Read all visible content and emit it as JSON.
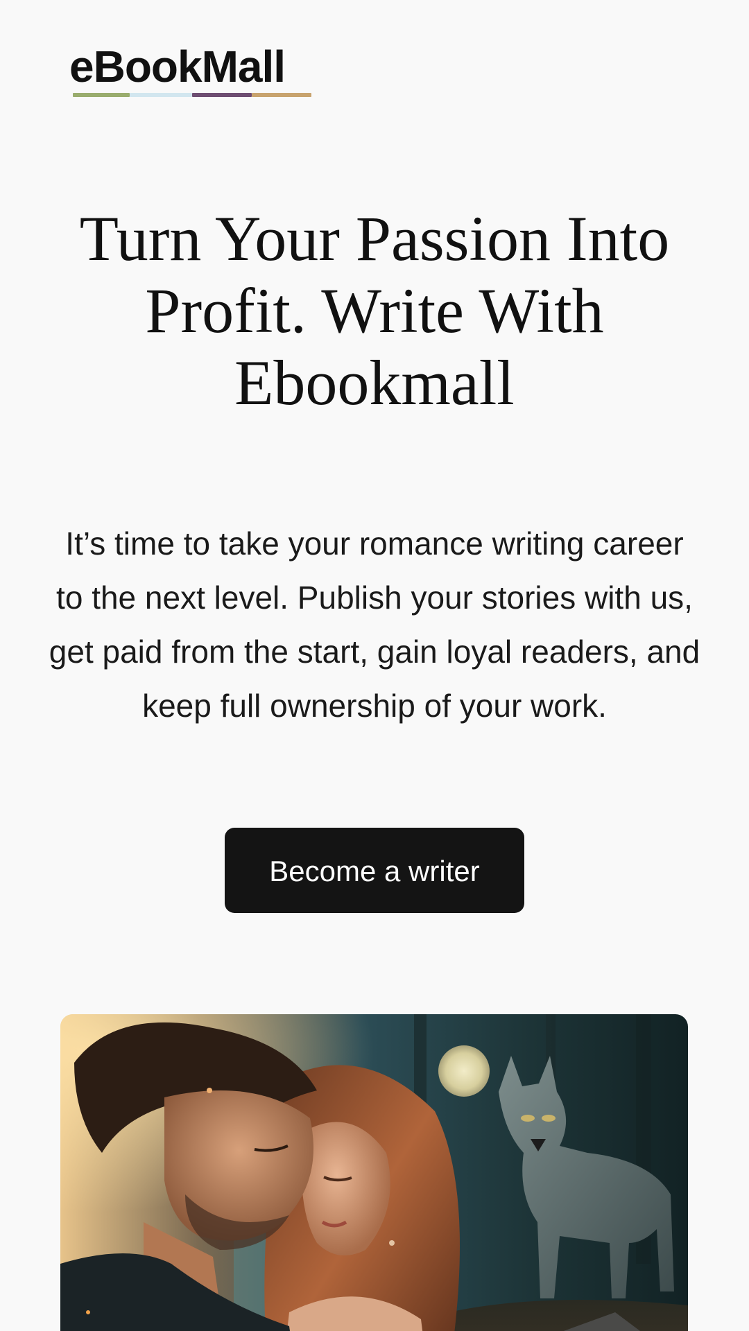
{
  "brand": {
    "logo_text": "eBookMall",
    "logo_stripe_colors": [
      "#9aad6e",
      "#d2e6ef",
      "#6e4e72",
      "#c8a36e"
    ]
  },
  "hero": {
    "title": "Turn Your Passion Into Profit. Write With Ebookmall",
    "description": "It’s time to take your romance writing career to the next level. Publish your stories with us, get paid from the start, gain loyal readers, and keep full ownership of your work.",
    "cta_label": "Become a writer"
  },
  "colors": {
    "background": "#f9f9f9",
    "text": "#111111",
    "button_bg": "#141414",
    "button_text": "#ffffff"
  }
}
